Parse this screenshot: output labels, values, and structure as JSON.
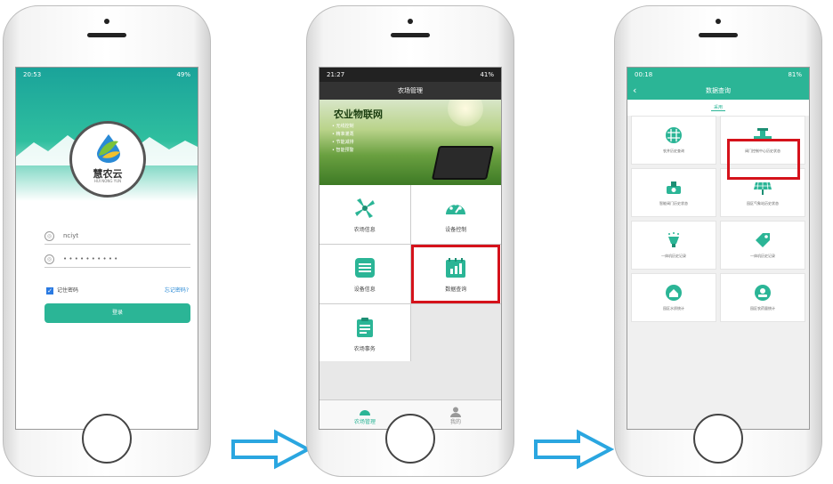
{
  "screen1": {
    "status_time": "20:53",
    "status_battery": "49%",
    "logo_text": "慧农云",
    "logo_sub": "HUI NONG YUN",
    "username_value": "nciyt",
    "password_value": "• • • • • • • • • •",
    "remember_label": "记住密码",
    "forgot_label": "忘记密码?",
    "login_label": "登录"
  },
  "screen2": {
    "status_time": "21:27",
    "status_battery": "41%",
    "title": "农场管理",
    "banner_title": "农业物联网",
    "banner_items": [
      "无线控制",
      "精准灌溉",
      "节能减排",
      "智能预警"
    ],
    "tiles": [
      {
        "label": "农场信息",
        "icon": "windmill-icon"
      },
      {
        "label": "设备控制",
        "icon": "gauge-icon"
      },
      {
        "label": "设备信息",
        "icon": "list-icon"
      },
      {
        "label": "数据查询",
        "icon": "bar-chart-icon"
      },
      {
        "label": "农场事务",
        "icon": "clipboard-icon"
      }
    ],
    "tabbar": [
      {
        "label": "农场管理",
        "active": true
      },
      {
        "label": "我的",
        "active": false
      }
    ]
  },
  "screen3": {
    "status_time": "00:18",
    "status_battery": "81%",
    "title": "数据查询",
    "subtab": "采用",
    "tiles": [
      {
        "label": "农井历史查询",
        "icon": "globe-grid-icon"
      },
      {
        "label": "阀门控制中心历史状态",
        "icon": "valve-icon"
      },
      {
        "label": "智能阀门历史状态",
        "icon": "meter-icon"
      },
      {
        "label": "园区气象站历史状态",
        "icon": "solar-panel-icon"
      },
      {
        "label": "一体机历史记录",
        "icon": "sprinkler-icon"
      },
      {
        "label": "一体机历史记录",
        "icon": "tag-icon"
      },
      {
        "label": "园区水质统计",
        "icon": "house-icon"
      },
      {
        "label": "园区农药量统计",
        "icon": "person-badge-icon"
      }
    ]
  },
  "colors": {
    "accent": "#2bb596",
    "highlight": "#d5121b",
    "arrow": "#2aa6e0"
  }
}
